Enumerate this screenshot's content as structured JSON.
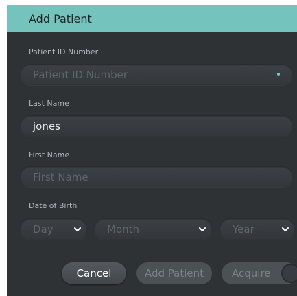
{
  "dialog": {
    "title": "Add Patient",
    "accent_color": "#74c3bc"
  },
  "form": {
    "patient_id": {
      "label": "Patient ID Number",
      "placeholder": "Patient ID Number",
      "value": "",
      "required": true
    },
    "last_name": {
      "label": "Last Name",
      "value": "jones"
    },
    "first_name": {
      "label": "First Name",
      "placeholder": "First Name",
      "value": ""
    },
    "dob": {
      "label": "Date of Birth",
      "day_placeholder": "Day",
      "month_placeholder": "Month",
      "year_placeholder": "Year"
    }
  },
  "buttons": {
    "cancel": "Cancel",
    "add_patient": "Add Patient",
    "acquire": "Acquire"
  }
}
